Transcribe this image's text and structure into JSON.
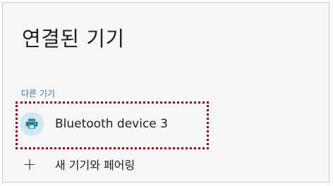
{
  "header": {
    "title": "연결된 기기"
  },
  "section": {
    "label": "다른 기기"
  },
  "devices": [
    {
      "label": "Bluetooth device 3",
      "icon": "printer-icon"
    }
  ],
  "actions": {
    "pair_new_label": "새 기기와 페어링",
    "pair_new_icon": "plus-icon"
  },
  "colors": {
    "accent": "#3f6fa8",
    "icon_bg": "#cfe9f4",
    "icon_fg": "#2e7d8e",
    "highlight": "#a0001c"
  }
}
